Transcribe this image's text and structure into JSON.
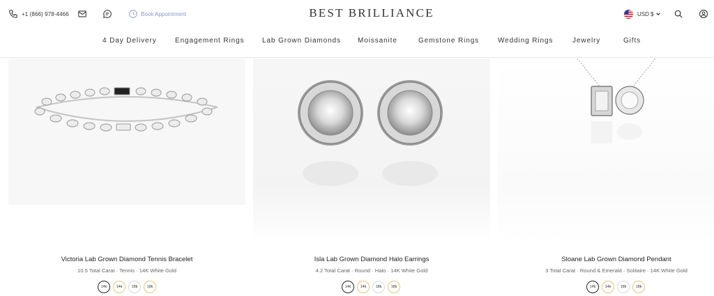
{
  "topbar": {
    "phone": "+1 (866) 978-4466",
    "appointment": "Book Appointment",
    "currency": "USD $",
    "icons": [
      "phone-icon",
      "mail-icon",
      "chat-icon",
      "calendar-icon",
      "us-flag-icon",
      "chevron-down-icon",
      "search-icon",
      "account-icon"
    ]
  },
  "brand": {
    "logo": "BEST BRILLIANCE"
  },
  "nav": {
    "items": [
      {
        "label": "4 Day Delivery"
      },
      {
        "label": "Engagement Rings"
      },
      {
        "label": "Lab Grown Diamonds"
      },
      {
        "label": "Moissanite"
      },
      {
        "label": "Gemstone Rings"
      },
      {
        "label": "Wedding Rings"
      },
      {
        "label": "Jewelry"
      },
      {
        "label": "Gifts"
      }
    ]
  },
  "products": [
    {
      "name": "Victoria Lab Grown Diamond Tennis Bracelet",
      "details": "10.5 Total Carat · Tennis · 14K White Gold",
      "metals": [
        "14k",
        "14k",
        "18k",
        "18k"
      ],
      "selected_metal": 0
    },
    {
      "name": "Isla Lab Grown Diamond Halo Earrings",
      "details": "4.2 Total Carat · Round · Halo · 14K White Gold",
      "metals": [
        "14k",
        "14k",
        "18k",
        "18k"
      ],
      "selected_metal": 0
    },
    {
      "name": "Sloane Lab Grown Diamond Pendant",
      "details": "3 Total Carat · Round & Emerald · Solitaire · 14K White Gold",
      "metals": [
        "14k",
        "14k",
        "18k",
        "18k"
      ],
      "selected_metal": 0
    }
  ],
  "colors": {
    "appointment_accent": "#8a96c9",
    "metal_white": "#d8d8d8",
    "metal_yellow": "#e5c57a",
    "metal_rose": "#e4b0a3"
  }
}
